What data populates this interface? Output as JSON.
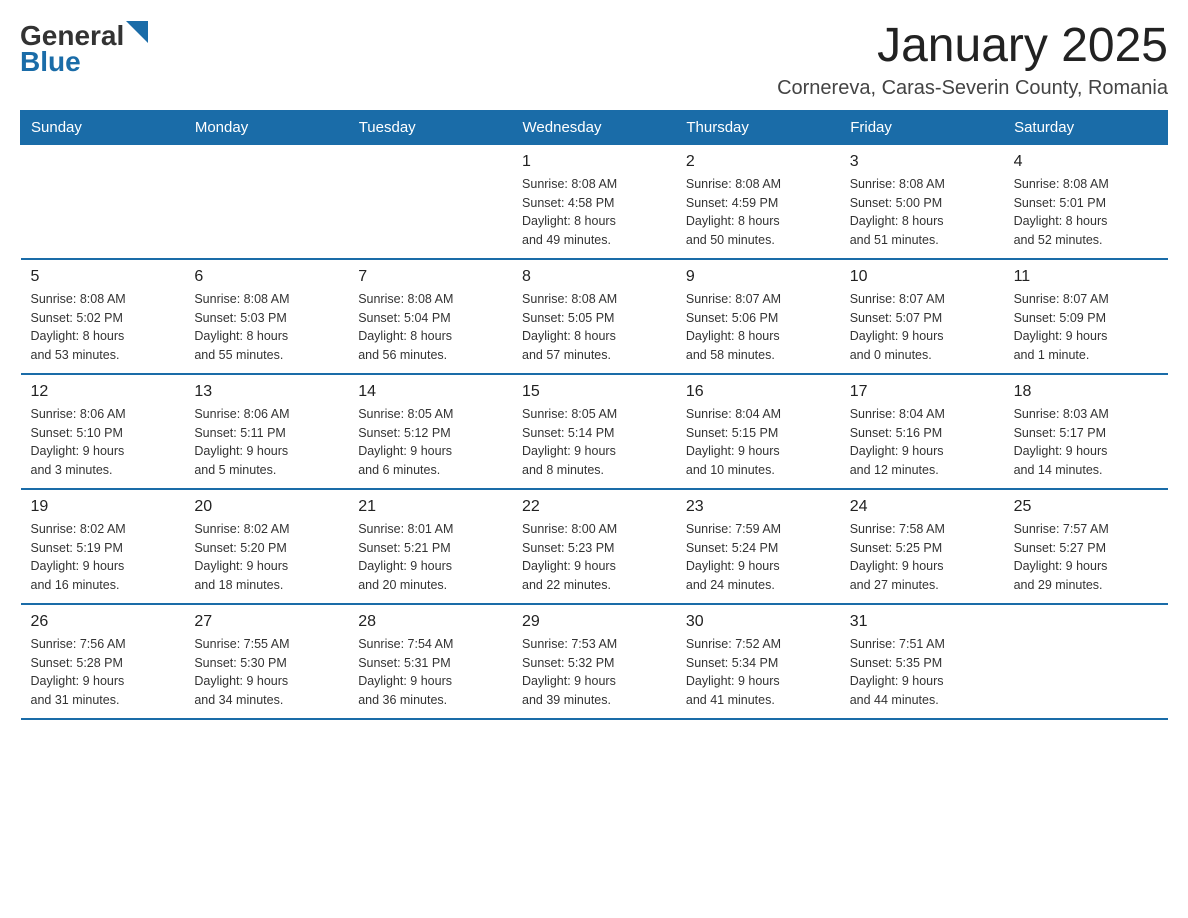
{
  "logo": {
    "general": "General",
    "blue": "Blue"
  },
  "title": "January 2025",
  "location": "Cornereva, Caras-Severin County, Romania",
  "weekdays": [
    "Sunday",
    "Monday",
    "Tuesday",
    "Wednesday",
    "Thursday",
    "Friday",
    "Saturday"
  ],
  "weeks": [
    [
      {
        "day": "",
        "info": ""
      },
      {
        "day": "",
        "info": ""
      },
      {
        "day": "",
        "info": ""
      },
      {
        "day": "1",
        "info": "Sunrise: 8:08 AM\nSunset: 4:58 PM\nDaylight: 8 hours\nand 49 minutes."
      },
      {
        "day": "2",
        "info": "Sunrise: 8:08 AM\nSunset: 4:59 PM\nDaylight: 8 hours\nand 50 minutes."
      },
      {
        "day": "3",
        "info": "Sunrise: 8:08 AM\nSunset: 5:00 PM\nDaylight: 8 hours\nand 51 minutes."
      },
      {
        "day": "4",
        "info": "Sunrise: 8:08 AM\nSunset: 5:01 PM\nDaylight: 8 hours\nand 52 minutes."
      }
    ],
    [
      {
        "day": "5",
        "info": "Sunrise: 8:08 AM\nSunset: 5:02 PM\nDaylight: 8 hours\nand 53 minutes."
      },
      {
        "day": "6",
        "info": "Sunrise: 8:08 AM\nSunset: 5:03 PM\nDaylight: 8 hours\nand 55 minutes."
      },
      {
        "day": "7",
        "info": "Sunrise: 8:08 AM\nSunset: 5:04 PM\nDaylight: 8 hours\nand 56 minutes."
      },
      {
        "day": "8",
        "info": "Sunrise: 8:08 AM\nSunset: 5:05 PM\nDaylight: 8 hours\nand 57 minutes."
      },
      {
        "day": "9",
        "info": "Sunrise: 8:07 AM\nSunset: 5:06 PM\nDaylight: 8 hours\nand 58 minutes."
      },
      {
        "day": "10",
        "info": "Sunrise: 8:07 AM\nSunset: 5:07 PM\nDaylight: 9 hours\nand 0 minutes."
      },
      {
        "day": "11",
        "info": "Sunrise: 8:07 AM\nSunset: 5:09 PM\nDaylight: 9 hours\nand 1 minute."
      }
    ],
    [
      {
        "day": "12",
        "info": "Sunrise: 8:06 AM\nSunset: 5:10 PM\nDaylight: 9 hours\nand 3 minutes."
      },
      {
        "day": "13",
        "info": "Sunrise: 8:06 AM\nSunset: 5:11 PM\nDaylight: 9 hours\nand 5 minutes."
      },
      {
        "day": "14",
        "info": "Sunrise: 8:05 AM\nSunset: 5:12 PM\nDaylight: 9 hours\nand 6 minutes."
      },
      {
        "day": "15",
        "info": "Sunrise: 8:05 AM\nSunset: 5:14 PM\nDaylight: 9 hours\nand 8 minutes."
      },
      {
        "day": "16",
        "info": "Sunrise: 8:04 AM\nSunset: 5:15 PM\nDaylight: 9 hours\nand 10 minutes."
      },
      {
        "day": "17",
        "info": "Sunrise: 8:04 AM\nSunset: 5:16 PM\nDaylight: 9 hours\nand 12 minutes."
      },
      {
        "day": "18",
        "info": "Sunrise: 8:03 AM\nSunset: 5:17 PM\nDaylight: 9 hours\nand 14 minutes."
      }
    ],
    [
      {
        "day": "19",
        "info": "Sunrise: 8:02 AM\nSunset: 5:19 PM\nDaylight: 9 hours\nand 16 minutes."
      },
      {
        "day": "20",
        "info": "Sunrise: 8:02 AM\nSunset: 5:20 PM\nDaylight: 9 hours\nand 18 minutes."
      },
      {
        "day": "21",
        "info": "Sunrise: 8:01 AM\nSunset: 5:21 PM\nDaylight: 9 hours\nand 20 minutes."
      },
      {
        "day": "22",
        "info": "Sunrise: 8:00 AM\nSunset: 5:23 PM\nDaylight: 9 hours\nand 22 minutes."
      },
      {
        "day": "23",
        "info": "Sunrise: 7:59 AM\nSunset: 5:24 PM\nDaylight: 9 hours\nand 24 minutes."
      },
      {
        "day": "24",
        "info": "Sunrise: 7:58 AM\nSunset: 5:25 PM\nDaylight: 9 hours\nand 27 minutes."
      },
      {
        "day": "25",
        "info": "Sunrise: 7:57 AM\nSunset: 5:27 PM\nDaylight: 9 hours\nand 29 minutes."
      }
    ],
    [
      {
        "day": "26",
        "info": "Sunrise: 7:56 AM\nSunset: 5:28 PM\nDaylight: 9 hours\nand 31 minutes."
      },
      {
        "day": "27",
        "info": "Sunrise: 7:55 AM\nSunset: 5:30 PM\nDaylight: 9 hours\nand 34 minutes."
      },
      {
        "day": "28",
        "info": "Sunrise: 7:54 AM\nSunset: 5:31 PM\nDaylight: 9 hours\nand 36 minutes."
      },
      {
        "day": "29",
        "info": "Sunrise: 7:53 AM\nSunset: 5:32 PM\nDaylight: 9 hours\nand 39 minutes."
      },
      {
        "day": "30",
        "info": "Sunrise: 7:52 AM\nSunset: 5:34 PM\nDaylight: 9 hours\nand 41 minutes."
      },
      {
        "day": "31",
        "info": "Sunrise: 7:51 AM\nSunset: 5:35 PM\nDaylight: 9 hours\nand 44 minutes."
      },
      {
        "day": "",
        "info": ""
      }
    ]
  ]
}
